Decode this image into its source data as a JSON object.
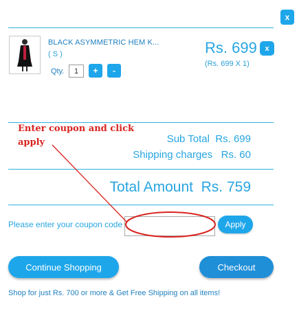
{
  "dialog": {
    "close_label": "x"
  },
  "item": {
    "name": "BLACK ASYMMETRIC HEM K...",
    "size": "( S )",
    "qty_label": "Qty.",
    "qty_value": "1",
    "plus_label": "+",
    "minus_label": "-",
    "price": "Rs. 699",
    "price_detail": "(Rs. 699 X 1)",
    "remove_label": "x"
  },
  "annotation": {
    "line1": "Enter coupon and click",
    "line2": "apply",
    "color": "#d8231f"
  },
  "summary": {
    "subtotal": "Sub Total  Rs. 699",
    "shipping": "Shipping charges   Rs. 60",
    "total": "Total Amount  Rs. 759"
  },
  "coupon": {
    "label": "Please enter your coupon code",
    "value": "",
    "apply_label": "Apply"
  },
  "actions": {
    "continue_label": "Continue Shopping",
    "checkout_label": "Checkout"
  },
  "promo": "Shop for just Rs. 700 or more & Get Free Shipping on all items!",
  "colors": {
    "accent": "#1ea6ea",
    "text_blue": "#27a5e0",
    "divider": "#2fb3dc"
  }
}
